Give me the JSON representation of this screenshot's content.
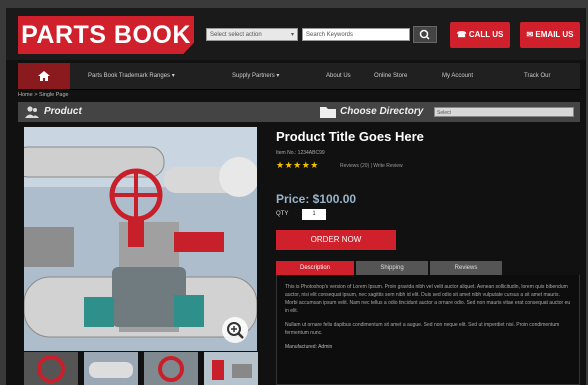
{
  "header": {
    "logo": "PARTS BOOK",
    "search_select": "Select select action",
    "search_placeholder": "Search Keywords",
    "call_label": "CALL US",
    "email_label": "EMAIL US"
  },
  "nav": {
    "items": [
      "Parts Book Trademark Ranges",
      "Supply Partners",
      "About Us",
      "Online Store",
      "My Account",
      "Track Our"
    ]
  },
  "breadcrumb": "Home > Single Page",
  "product_bar": {
    "label": "Product",
    "choose_label": "Choose Directory",
    "select_value": "Select"
  },
  "product": {
    "title": "Product Title Goes Here",
    "item_no": "Item No.: 1234ABC99",
    "stars": "★★★★★",
    "reviews": "Reviews (20) | Write Review",
    "price": "Price: $100.00",
    "qty_label": "QTY",
    "qty_value": "1",
    "order_label": "ORDER NOW"
  },
  "tabs": [
    "Description",
    "Shipping",
    "Reviews"
  ],
  "description": {
    "para1": "This is Photoshop's version of Lorem Ipsum. Proin gravida nibh vel velit auctor aliquet. Aenean sollicitudin, lorem quis bibendum auctor, nisi elit consequat ipsum, nec sagittis sem nibh id elit. Duis sed odio sit amet nibh vulputate cursus a sit amet mauris. Morbi accumsan ipsum velit. Nam nec tellus a odio tincidunt auctor a ornare odio. Sed non mauris vitae erat consequat auctor eu in elit.",
    "para2": "Nullam ut ornare felis dapibus condimentum sit amet a augue. Sed non neque elit. Sed ut imperdiet nisi. Proin condimentum fermentum nunc.",
    "meta": "Manufactured: Admin"
  },
  "colors": {
    "brand_red": "#d0202b",
    "nav_home": "#8b1a1f",
    "price_blue": "#9ab3c8",
    "star_gold": "#f2c200"
  }
}
